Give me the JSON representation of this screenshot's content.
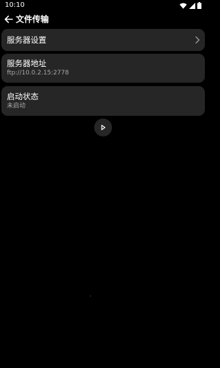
{
  "status_bar": {
    "time": "10:10",
    "icons": [
      "wifi-icon",
      "signal-icon",
      "battery-icon"
    ]
  },
  "app_bar": {
    "title": "文件传输",
    "back_icon": "arrow-left-icon"
  },
  "cards": {
    "settings": {
      "title": "服务器设置",
      "icon": "chevron-right-icon"
    },
    "address": {
      "title": "服务器地址",
      "value": "ftp://10.0.2.15:2778"
    },
    "status": {
      "title": "启动状态",
      "value": "未启动"
    }
  },
  "play_button": {
    "icon": "play-icon"
  },
  "colors": {
    "background": "#000000",
    "card": "#262626",
    "text": "#ffffff",
    "subtext": "#a8a8a8"
  }
}
